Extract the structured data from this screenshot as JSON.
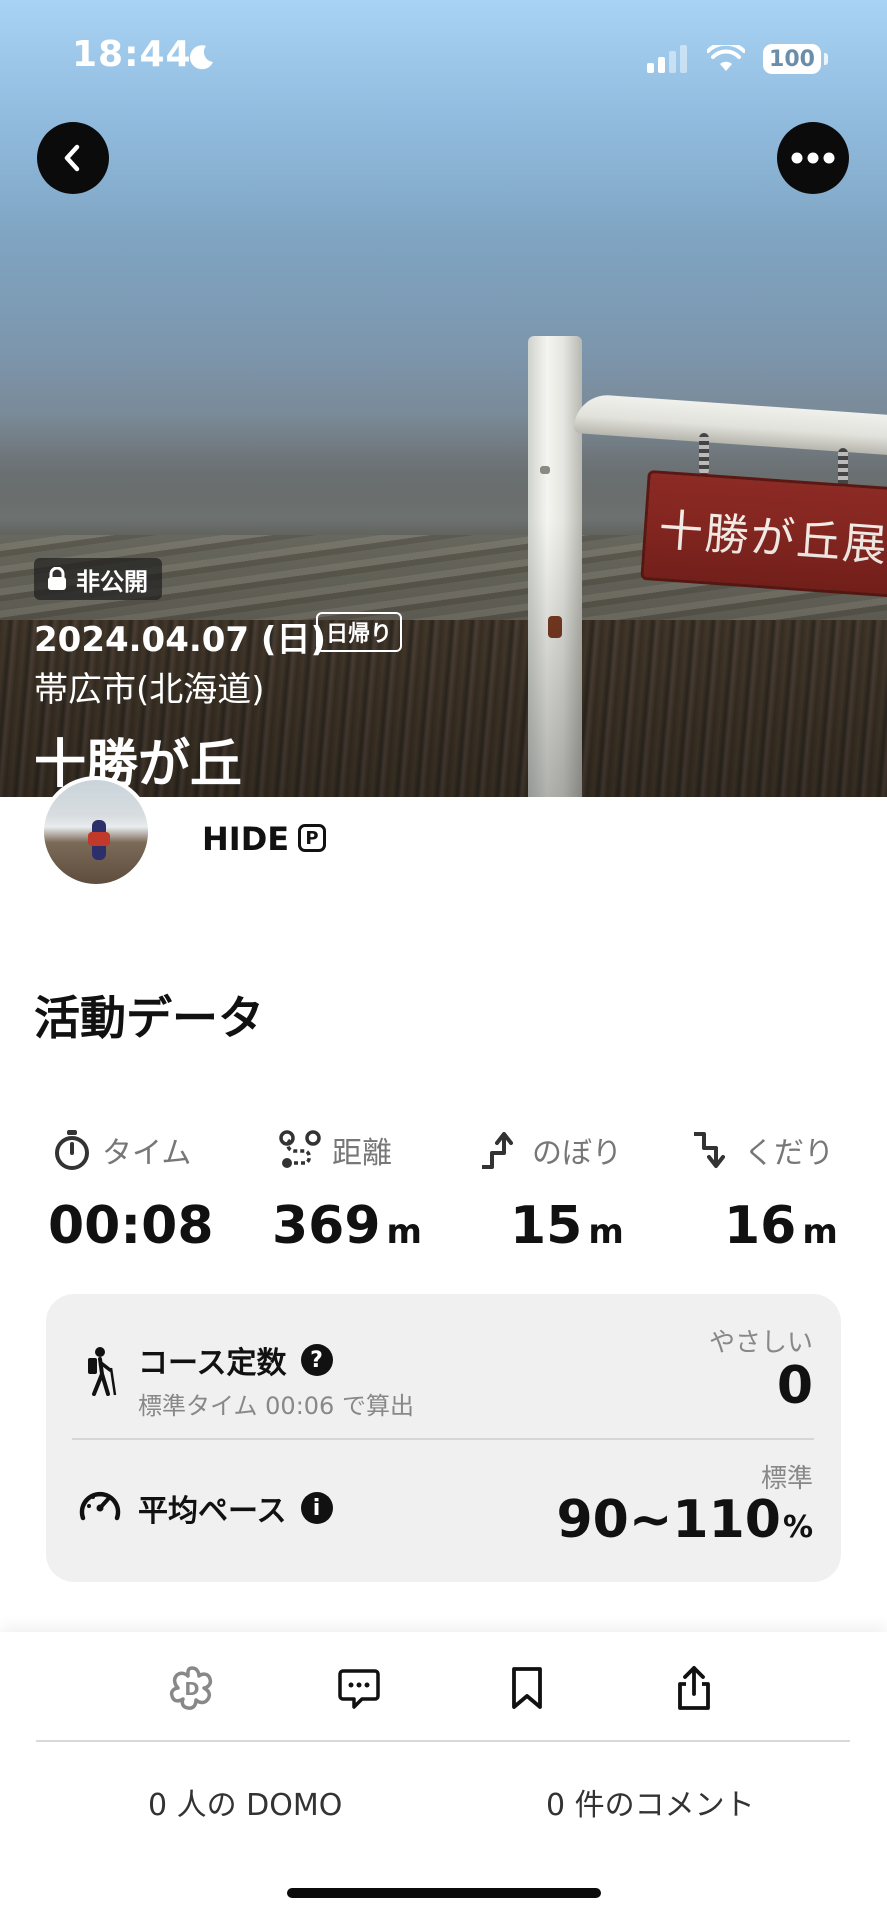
{
  "status_bar": {
    "time": "18:44",
    "battery": "100"
  },
  "header": {
    "private_label": "非公開",
    "date": "2024.04.07 (日)",
    "trip_type": "日帰り",
    "location": "帯広市(北海道)",
    "title": "十勝が丘",
    "photo_sign_text": "十勝が丘展望台"
  },
  "user": {
    "name": "HIDE",
    "badge": "P"
  },
  "activity": {
    "section_title": "活動データ",
    "stats": [
      {
        "label": "タイム",
        "value": "00:08",
        "unit": ""
      },
      {
        "label": "距離",
        "value": "369",
        "unit": "m"
      },
      {
        "label": "のぼり",
        "value": "15",
        "unit": "m"
      },
      {
        "label": "くだり",
        "value": "16",
        "unit": "m"
      }
    ],
    "course": {
      "label": "コース定数",
      "sub": "標準タイム 00:06 で算出",
      "level": "やさしい",
      "value": "0"
    },
    "pace": {
      "label": "平均ペース",
      "level": "標準",
      "value": "90~110",
      "unit": "%"
    }
  },
  "footer": {
    "domo_count": "0 人の DOMO",
    "comment_count": "0 件のコメント"
  },
  "colors": {
    "accent": "#111111",
    "muted": "#888888",
    "card_bg": "#f0f0f0"
  }
}
